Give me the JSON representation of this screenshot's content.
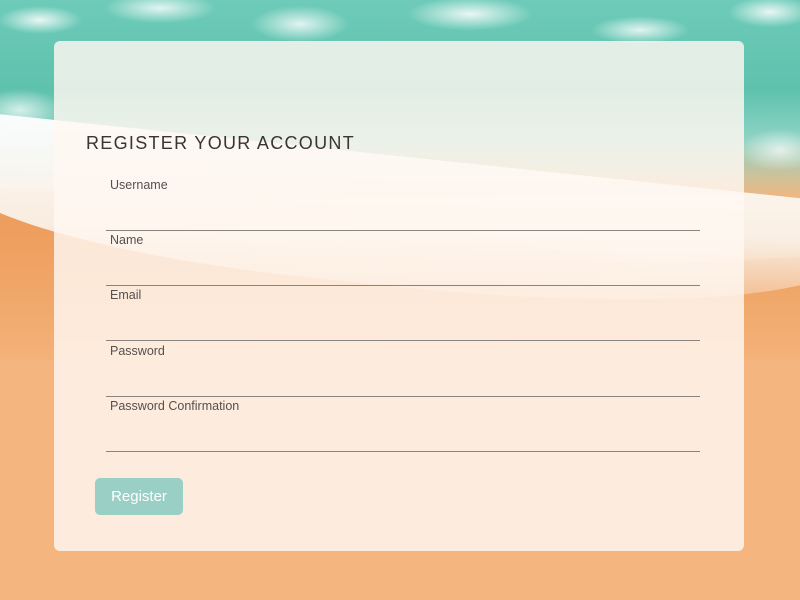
{
  "form": {
    "title": "REGISTER YOUR ACCOUNT",
    "fields": [
      {
        "label": "Username",
        "value": "",
        "type": "text"
      },
      {
        "label": "Name",
        "value": "",
        "type": "text"
      },
      {
        "label": "Email",
        "value": "",
        "type": "email"
      },
      {
        "label": "Password",
        "value": "",
        "type": "password"
      },
      {
        "label": "Password Confirmation",
        "value": "",
        "type": "password"
      }
    ],
    "submit_label": "Register"
  },
  "colors": {
    "button_bg": "#9acfc6",
    "button_text": "#ffffff",
    "card_bg": "#fff8f2",
    "title_text": "#3a3432",
    "sand": "#f4b67e",
    "sea": "#6ecbb9"
  }
}
